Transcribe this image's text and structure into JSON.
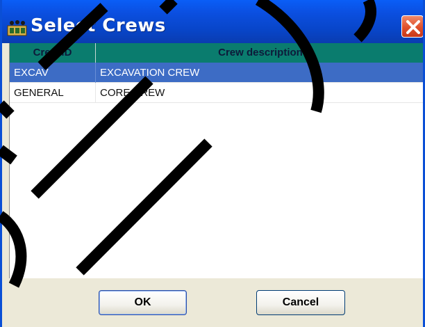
{
  "window": {
    "title": "Select Crews"
  },
  "table": {
    "columns": [
      "Crew ID",
      "Crew description"
    ],
    "rows": [
      {
        "id": "EXCAV",
        "description": "EXCAVATION CREW",
        "selected": true
      },
      {
        "id": "GENERAL",
        "description": "CORE CREW",
        "selected": false
      }
    ]
  },
  "buttons": {
    "ok_label": "OK",
    "cancel_label": "Cancel"
  },
  "colors": {
    "titlebar": "#0b4fe0",
    "header": "#0a7c6e",
    "selection": "#3d6cc5",
    "close": "#e0502a"
  },
  "icons": {
    "app": "crew-app-icon",
    "close": "close-icon"
  }
}
